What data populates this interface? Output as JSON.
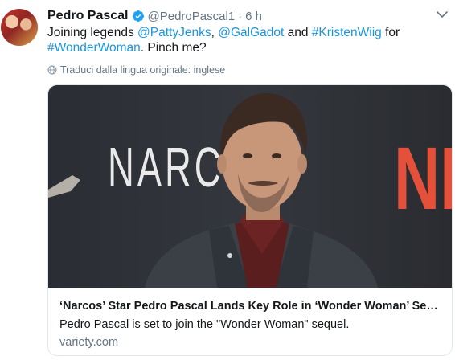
{
  "author": {
    "display_name": "Pedro Pascal",
    "handle": "@PedroPascal1",
    "time": "6 h",
    "separator": "·"
  },
  "tweet": {
    "text_before": "Joining legends ",
    "mention1": "@PattyJenks",
    "sep1": ", ",
    "mention2": "@GalGadot",
    "sep2": " and ",
    "hashtag1": "#KristenWiig",
    "sep3": " for ",
    "hashtag2": "#WonderWoman",
    "text_after": ". Pinch me?"
  },
  "translate": {
    "label": "Traduci dalla lingua originale: inglese"
  },
  "card": {
    "backdrop_left": "NARC",
    "backdrop_right": "NE",
    "title": "‘Narcos’ Star Pedro Pascal Lands Key Role in ‘Wonder Woman’ Sequel",
    "description": "Pedro Pascal is set to join the \"Wonder Woman\" sequel.",
    "domain": "variety.com"
  },
  "icons": {
    "verified": "verified-badge-icon",
    "caret": "chevron-down-icon",
    "translate": "globe-icon"
  },
  "colors": {
    "link": "#1b95e0",
    "verified": "#1da1f2",
    "secondary_text": "#657786",
    "card_border": "#e1e8ed",
    "backdrop_red": "#e5503b"
  }
}
